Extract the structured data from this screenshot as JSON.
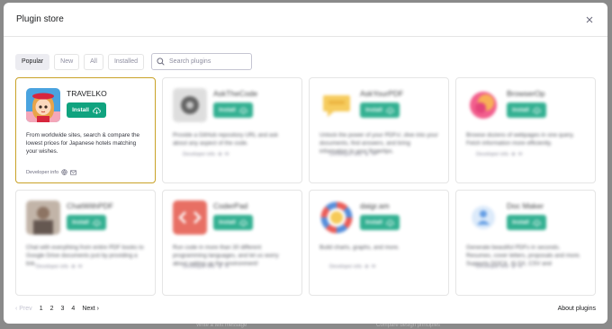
{
  "backdrop": {
    "left_text": "Write a text message",
    "right_text": "Compare design principles"
  },
  "modal": {
    "title": "Plugin store",
    "close_icon": "close-icon"
  },
  "filters": [
    {
      "label": "Popular",
      "active": true
    },
    {
      "label": "New",
      "active": false
    },
    {
      "label": "All",
      "active": false
    },
    {
      "label": "Installed",
      "active": false
    }
  ],
  "search": {
    "placeholder": "Search plugins",
    "icon": "search-icon"
  },
  "plugins": [
    {
      "name": "TRAVELKO",
      "install_label": "Install",
      "description": "From worldwide sites, search & compare the lowest prices for Japanese hotels matching your wishes.",
      "developer_info": "Developer info",
      "logo": "travelko-girl-logo"
    },
    {
      "name": "AskTheCode",
      "install_label": "Install",
      "description": "Provide a GitHub repository URL and ask about any aspect of the code.",
      "developer_info": "Developer info",
      "logo": "askthecode-logo"
    },
    {
      "name": "AskYourPDF",
      "install_label": "Install",
      "description": "Unlock the power of your PDFs!, dive into your documents, find answers, and bring information to your fingertips.",
      "developer_info": "Developer info",
      "logo": "askyourpdf-logo"
    },
    {
      "name": "BrowserOp",
      "install_label": "Install",
      "description": "Browse dozens of webpages in one query. Fetch information more efficiently.",
      "developer_info": "Developer info",
      "logo": "browserop-logo"
    },
    {
      "name": "ChatWithPDF",
      "install_label": "Install",
      "description": "Chat with everything from entire PDF books to Google Drive documents just by providing a link.",
      "developer_info": "Developer info",
      "logo": "chatwithpdf-logo"
    },
    {
      "name": "CoderPad",
      "install_label": "Install",
      "description": "Run code in more than 30 different programming languages, and let us worry about setting up the environment!",
      "developer_info": "Developer info",
      "logo": "coderpad-logo"
    },
    {
      "name": "daigr.am",
      "install_label": "Install",
      "description": "Build charts, graphs, and more.",
      "developer_info": "Developer info",
      "logo": "daigram-logo"
    },
    {
      "name": "Doc Maker",
      "install_label": "Install",
      "description": "Generate beautiful PDFs in seconds. Resumes, cover letters, proposals and more. Supports DOCX, XLSX, CSV and",
      "developer_info": "Developer info",
      "logo": "docmaker-logo"
    }
  ],
  "pagination": {
    "prev": "Prev",
    "pages": [
      "1",
      "2",
      "3",
      "4"
    ],
    "next": "Next"
  },
  "about": "About plugins",
  "colors": {
    "install_green": "#10a37f",
    "selected_border": "#c9a227"
  }
}
